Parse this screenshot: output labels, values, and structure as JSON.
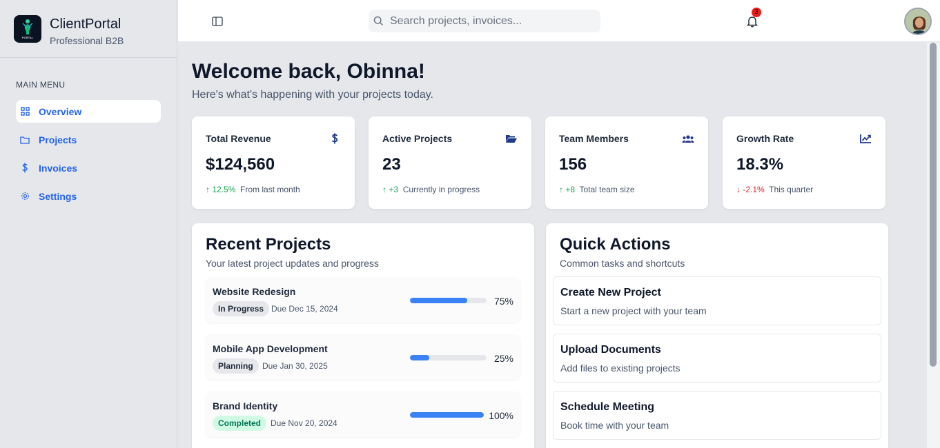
{
  "brand": {
    "title": "ClientPortal",
    "subtitle": "Professional B2B",
    "logo_text": "PORTAL"
  },
  "sidebar": {
    "heading": "MAIN MENU",
    "items": [
      {
        "label": "Overview",
        "icon": "grid-icon",
        "active": true
      },
      {
        "label": "Projects",
        "icon": "folder-icon"
      },
      {
        "label": "Invoices",
        "icon": "dollar-icon"
      },
      {
        "label": "Settings",
        "icon": "gear-icon"
      }
    ]
  },
  "header": {
    "search_placeholder": "Search projects, invoices...",
    "notification_count": "3"
  },
  "welcome": {
    "title": "Welcome back, Obinna!",
    "subtitle": "Here's what's happening with your projects today."
  },
  "stats": [
    {
      "title": "Total Revenue",
      "icon": "dollar-icon",
      "value": "$124,560",
      "change": "↑ 12.5%",
      "note": "From last month",
      "trend": "up"
    },
    {
      "title": "Active Projects",
      "icon": "folder-open-icon",
      "value": "23",
      "change": "↑ +3",
      "note": "Currently in progress",
      "trend": "up"
    },
    {
      "title": "Team Members",
      "icon": "users-icon",
      "value": "156",
      "change": "↑ +8",
      "note": "Total team size",
      "trend": "up"
    },
    {
      "title": "Growth Rate",
      "icon": "chart-line-icon",
      "value": "18.3%",
      "change": "↓ -2.1%",
      "note": "This quarter",
      "trend": "down"
    }
  ],
  "recent": {
    "title": "Recent Projects",
    "subtitle": "Your latest project updates and progress",
    "projects": [
      {
        "name": "Website Redesign",
        "status": "In Progress",
        "due": "Due Dec 15, 2024",
        "progress": 75,
        "progress_label": "75%"
      },
      {
        "name": "Mobile App Development",
        "status": "Planning",
        "due": "Due Jan 30, 2025",
        "progress": 25,
        "progress_label": "25%"
      },
      {
        "name": "Brand Identity",
        "status": "Completed",
        "due": "Due Nov 20, 2024",
        "progress": 100,
        "progress_label": "100%"
      }
    ]
  },
  "quick": {
    "title": "Quick Actions",
    "subtitle": "Common tasks and shortcuts",
    "actions": [
      {
        "title": "Create New Project",
        "desc": "Start a new project with your team"
      },
      {
        "title": "Upload Documents",
        "desc": "Add files to existing projects"
      },
      {
        "title": "Schedule Meeting",
        "desc": "Book time with your team"
      }
    ]
  },
  "colors": {
    "accent": "#2563eb",
    "progress": "#3b82f6",
    "up": "#16a34a",
    "down": "#dc2626"
  }
}
